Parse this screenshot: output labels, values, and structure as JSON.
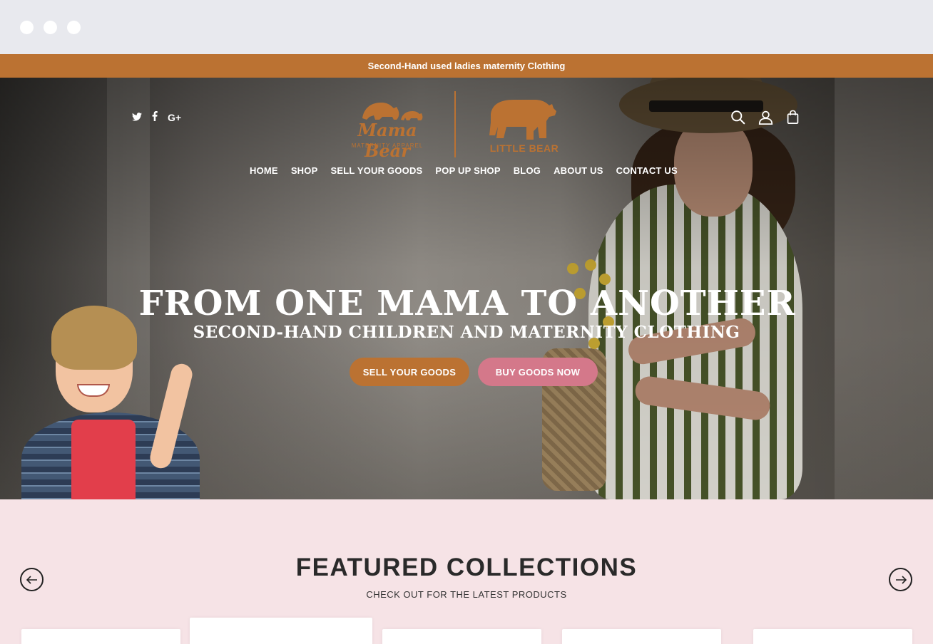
{
  "announcement": "Second-Hand used ladies maternity Clothing",
  "social": [
    {
      "icon": "twitter-icon",
      "label": "t"
    },
    {
      "icon": "facebook-icon",
      "label": "f"
    },
    {
      "icon": "google-plus-icon",
      "label": "G+"
    }
  ],
  "logos": {
    "mama_bear": {
      "name": "MamaBear",
      "tagline": "MATERNITY APPAREL"
    },
    "little_bear": {
      "name": "LITTLE BEAR"
    }
  },
  "header_icons": [
    "search-icon",
    "user-icon",
    "shopping-bag-icon"
  ],
  "nav": {
    "items": [
      "HOME",
      "SHOP",
      "SELL YOUR GOODS",
      "POP UP SHOP",
      "BLOG",
      "ABOUT US",
      "CONTACT US"
    ]
  },
  "hero": {
    "title": "FROM ONE MAMA TO ANOTHER",
    "subtitle": "SECOND-HAND CHILDREN AND MATERNITY CLOTHING",
    "sell_button": "SELL YOUR GOODS",
    "buy_button": "BUY GOODS NOW"
  },
  "featured": {
    "title": "FEATURED COLLECTIONS",
    "subtitle": "CHECK OUT FOR THE LATEST PRODUCTS"
  },
  "colors": {
    "brand_brown": "#bb7232",
    "brand_pink": "#d4788a",
    "featured_bg": "#f6e3e6"
  }
}
